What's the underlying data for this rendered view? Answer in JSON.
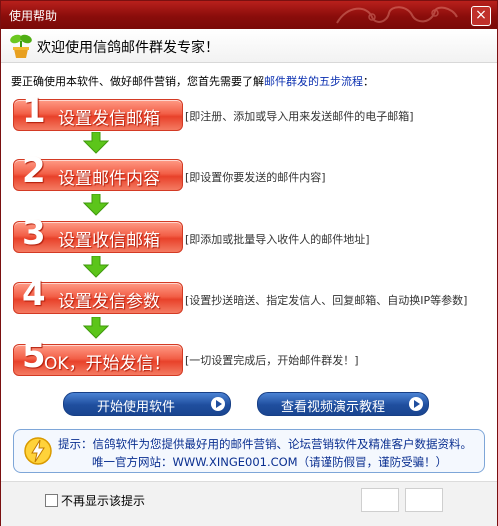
{
  "window": {
    "title": "使用帮助",
    "close_label": "×"
  },
  "welcome": {
    "text": "欢迎使用信鸽邮件群发专家！"
  },
  "intro": {
    "prefix": "要正确使用本软件、做好邮件营销，您首先需要了解",
    "highlight": "邮件群发的五步流程",
    "suffix": "："
  },
  "steps": [
    {
      "number": "1",
      "label": "设置发信邮箱",
      "desc": "[即注册、添加或导入用来发送邮件的电子邮箱]"
    },
    {
      "number": "2",
      "label": "设置邮件内容",
      "desc": "[即设置你要发送的邮件内容]"
    },
    {
      "number": "3",
      "label": "设置收信邮箱",
      "desc": "[即添加或批量导入收件人的邮件地址]"
    },
    {
      "number": "4",
      "label": "设置发信参数",
      "desc": "[设置抄送暗送、指定发信人、回复邮箱、自动换IP等参数]"
    },
    {
      "number": "5",
      "label": "OK，开始发信！",
      "desc": "[一切设置完成后，开始邮件群发！]"
    }
  ],
  "buttons": {
    "start": "开始使用软件",
    "video": "查看视频演示教程"
  },
  "tip": {
    "line1": "提示：信鸽软件为您提供最好用的邮件营销、论坛营销软件及精准客户数据资料。",
    "line2": "唯一官方网站：WWW.XINGE001.COM（请谨防假冒，谨防受骗！）"
  },
  "footer": {
    "dont_show": "不再显示该提示"
  },
  "colors": {
    "title_bar": "#8a0d0b",
    "step_red": "#f26048",
    "arrow_green": "#5cc51a",
    "button_blue": "#1f4e9e",
    "link_blue": "#0a2fb0"
  }
}
